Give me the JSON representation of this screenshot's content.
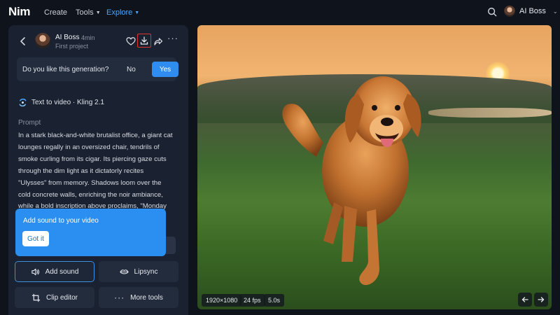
{
  "app": {
    "logo": "Nim"
  },
  "nav": {
    "items": [
      {
        "label": "Create"
      },
      {
        "label": "Tools"
      },
      {
        "label": "Explore"
      }
    ]
  },
  "user": {
    "name": "AI Boss"
  },
  "post": {
    "author": "AI Boss",
    "time": "4min",
    "project": "First project"
  },
  "feedback": {
    "question": "Do you like this generation?",
    "no_label": "No",
    "yes_label": "Yes"
  },
  "generation": {
    "mode": "Text to video · Kling 2.1"
  },
  "prompt": {
    "label": "Prompt",
    "text": "In a stark black-and-white brutalist office, a giant cat lounges regally in an oversized chair, tendrils of smoke curling from its cigar. Its piercing gaze cuts through the dim light as it dictatorly recites \"Ulysses\" from memory. Shadows loom over the cold concrete walls, enriching the noir ambiance, while a bold inscription above proclaims, \"Monday starts softly,\" highlighting the fallen's commanding presence."
  },
  "callout": {
    "text": "Add sound to your video",
    "button": "Got it"
  },
  "tools": {
    "add_sound": "Add sound",
    "lipsync": "Lipsync",
    "clip_editor": "Clip editor",
    "more_tools": "More tools"
  },
  "media": {
    "resolution": "1920×1080",
    "fps": "24 fps",
    "duration": "5.0s"
  },
  "colors": {
    "accent": "#2f8df2",
    "nav_active": "#4aa6ff",
    "highlight_border": "#e0322f",
    "panel": "#1a2130",
    "background": "#0f141c"
  }
}
